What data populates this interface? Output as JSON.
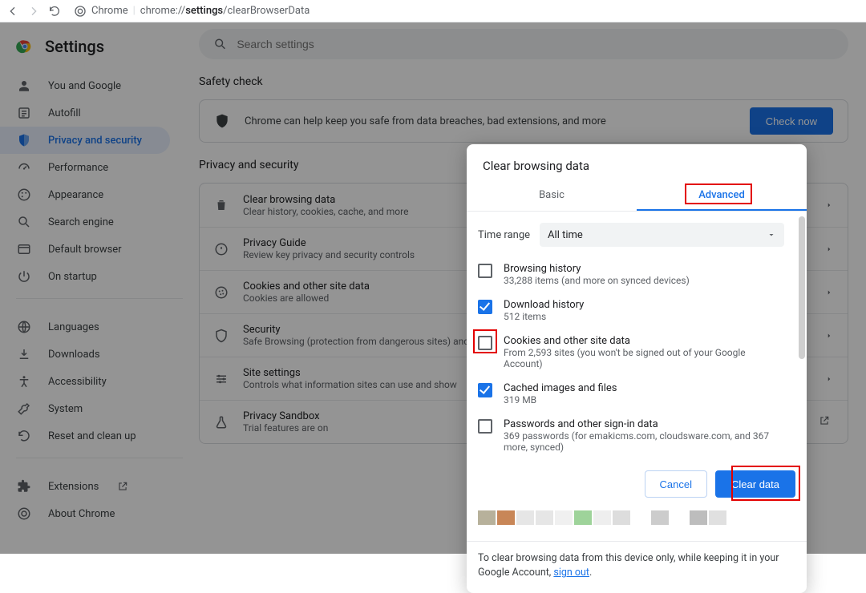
{
  "browser": {
    "app_label": "Chrome",
    "url_display_pre": "chrome://",
    "url_display_bold": "settings",
    "url_display_post": "/clearBrowserData"
  },
  "title": "Settings",
  "search_placeholder": "Search settings",
  "nav": {
    "items": [
      {
        "label": "You and Google",
        "icon": "person"
      },
      {
        "label": "Autofill",
        "icon": "autofill"
      },
      {
        "label": "Privacy and security",
        "icon": "shield",
        "active": true
      },
      {
        "label": "Performance",
        "icon": "speed"
      },
      {
        "label": "Appearance",
        "icon": "palette"
      },
      {
        "label": "Search engine",
        "icon": "search"
      },
      {
        "label": "Default browser",
        "icon": "browser"
      },
      {
        "label": "On startup",
        "icon": "power"
      }
    ],
    "items2": [
      {
        "label": "Languages",
        "icon": "globe"
      },
      {
        "label": "Downloads",
        "icon": "download"
      },
      {
        "label": "Accessibility",
        "icon": "access"
      },
      {
        "label": "System",
        "icon": "wrench"
      },
      {
        "label": "Reset and clean up",
        "icon": "reset"
      }
    ],
    "items3": [
      {
        "label": "Extensions",
        "icon": "extension",
        "external": true
      },
      {
        "label": "About Chrome",
        "icon": "chrome"
      }
    ]
  },
  "safety": {
    "section": "Safety check",
    "text": "Chrome can help keep you safe from data breaches, bad extensions, and more",
    "button": "Check now"
  },
  "privacy": {
    "section": "Privacy and security",
    "items": [
      {
        "t1": "Clear browsing data",
        "t2": "Clear history, cookies, cache, and more",
        "icon": "trash"
      },
      {
        "t1": "Privacy Guide",
        "t2": "Review key privacy and security controls",
        "icon": "guide"
      },
      {
        "t1": "Cookies and other site data",
        "t2": "Cookies are allowed",
        "icon": "cookie"
      },
      {
        "t1": "Security",
        "t2": "Safe Browsing (protection from dangerous sites) and other security settings",
        "icon": "shield2"
      },
      {
        "t1": "Site settings",
        "t2": "Controls what information sites can use and show",
        "icon": "tune"
      },
      {
        "t1": "Privacy Sandbox",
        "t2": "Trial features are on",
        "icon": "flask",
        "external": true
      }
    ]
  },
  "modal": {
    "title": "Clear browsing data",
    "tabs": {
      "basic": "Basic",
      "advanced": "Advanced",
      "active": "advanced"
    },
    "time_label": "Time range",
    "time_value": "All time",
    "items": [
      {
        "t1": "Browsing history",
        "t2": "33,288 items (and more on synced devices)",
        "checked": false,
        "hl": false
      },
      {
        "t1": "Download history",
        "t2": "512 items",
        "checked": true,
        "hl": false
      },
      {
        "t1": "Cookies and other site data",
        "t2": "From 2,593 sites (you won't be signed out of your Google Account)",
        "checked": false,
        "hl": true
      },
      {
        "t1": "Cached images and files",
        "t2": "319 MB",
        "checked": true,
        "hl": false
      },
      {
        "t1": "Passwords and other sign-in data",
        "t2": "369 passwords (for emakicms.com, cloudsware.com, and 367 more, synced)",
        "checked": false,
        "hl": false
      }
    ],
    "cancel": "Cancel",
    "clear": "Clear data",
    "footer_pre": "To clear browsing data from this device only, while keeping it in your Google Account, ",
    "footer_link": "sign out",
    "footer_post": "."
  }
}
